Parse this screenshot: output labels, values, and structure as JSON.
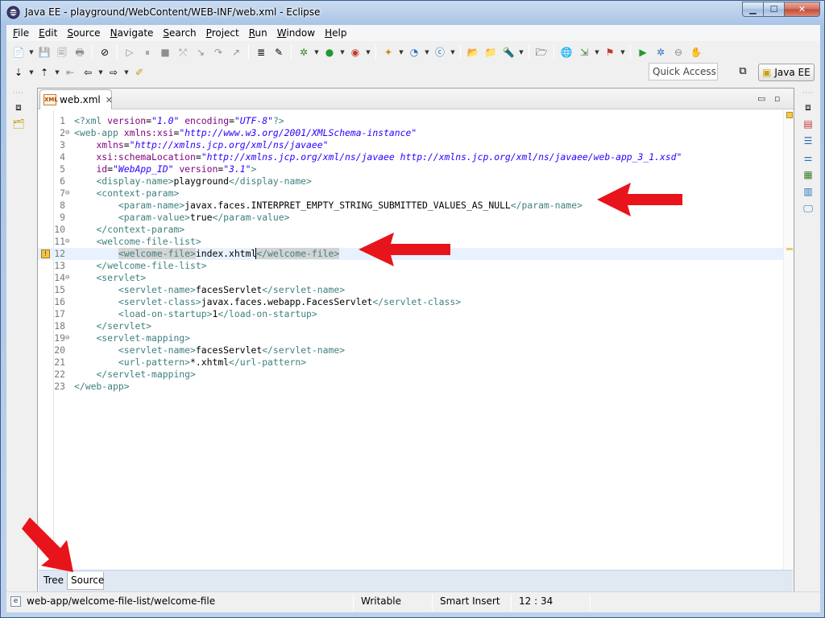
{
  "window": {
    "title": "Java EE - playground/WebContent/WEB-INF/web.xml - Eclipse",
    "min_label": "▁",
    "max_label": "☐",
    "close_label": "✕"
  },
  "menubar": [
    {
      "mnemonic": "F",
      "rest": "ile"
    },
    {
      "mnemonic": "E",
      "rest": "dit"
    },
    {
      "mnemonic": "S",
      "rest": "ource"
    },
    {
      "mnemonic": "N",
      "rest": "avigate"
    },
    {
      "mnemonic": "S",
      "rest": "earch"
    },
    {
      "mnemonic": "P",
      "rest": "roject"
    },
    {
      "mnemonic": "R",
      "rest": "un"
    },
    {
      "mnemonic": "W",
      "rest": "indow"
    },
    {
      "mnemonic": "H",
      "rest": "elp"
    }
  ],
  "toolbar": {
    "quick_access": "Quick Access",
    "perspective": "Java EE"
  },
  "editor": {
    "tab_label": "web.xml",
    "tab_icon_text": "XML",
    "close_glyph": "✕",
    "minimize_glyph": "▭",
    "maximize_glyph": "▫",
    "lines": [
      {
        "n": "1",
        "fold": "",
        "html": "<span class=\"tag\">&lt;?xml</span> <span class=\"attr\">version</span>=<span class=\"str\">\"1.0\"</span> <span class=\"attr\">encoding</span>=<span class=\"str\">\"UTF-8\"</span><span class=\"tag\">?&gt;</span>"
      },
      {
        "n": "2",
        "fold": "⊖",
        "html": "<span class=\"tag\">&lt;web-app</span> <span class=\"attr\">xmlns:xsi</span>=<span class=\"str\">\"http://www.w3.org/2001/XMLSchema-instance\"</span>"
      },
      {
        "n": "3",
        "fold": "",
        "html": "    <span class=\"attr\">xmlns</span>=<span class=\"str\">\"http://xmlns.jcp.org/xml/ns/javaee\"</span>"
      },
      {
        "n": "4",
        "fold": "",
        "html": "    <span class=\"attr\">xsi:schemaLocation</span>=<span class=\"str\">\"http://xmlns.jcp.org/xml/ns/javaee http://xmlns.jcp.org/xml/ns/javaee/web-app_3_1.xsd\"</span>"
      },
      {
        "n": "5",
        "fold": "",
        "html": "    <span class=\"attr\">id</span>=<span class=\"str\">\"WebApp_ID\"</span> <span class=\"attr\">version</span>=<span class=\"str\">\"3.1\"</span><span class=\"tag\">&gt;</span>"
      },
      {
        "n": "6",
        "fold": "",
        "html": "    <span class=\"tag\">&lt;display-name&gt;</span><span class=\"txt\">playground</span><span class=\"tag\">&lt;/display-name&gt;</span>"
      },
      {
        "n": "7",
        "fold": "⊖",
        "html": "    <span class=\"tag\">&lt;context-param&gt;</span>"
      },
      {
        "n": "8",
        "fold": "",
        "html": "        <span class=\"tag\">&lt;param-name&gt;</span><span class=\"txt\">javax.faces.INTERPRET_EMPTY_STRING_SUBMITTED_VALUES_AS_NULL</span><span class=\"tag\">&lt;/param-name&gt;</span>"
      },
      {
        "n": "9",
        "fold": "",
        "html": "        <span class=\"tag\">&lt;param-value&gt;</span><span class=\"txt\">true</span><span class=\"tag\">&lt;/param-value&gt;</span>"
      },
      {
        "n": "10",
        "fold": "",
        "html": "    <span class=\"tag\">&lt;/context-param&gt;</span>"
      },
      {
        "n": "11",
        "fold": "⊖",
        "html": "    <span class=\"tag\">&lt;welcome-file-list&gt;</span>"
      },
      {
        "n": "12",
        "fold": "",
        "current": true,
        "html": "        <span class=\"tag hl\">&lt;welcome-file&gt;</span><span class=\"txt\">index.xhtml</span><span class=\"tag hl caret\">&lt;/welcome-file&gt;</span>"
      },
      {
        "n": "13",
        "fold": "",
        "html": "    <span class=\"tag\">&lt;/welcome-file-list&gt;</span>"
      },
      {
        "n": "14",
        "fold": "⊖",
        "html": "    <span class=\"tag\">&lt;servlet&gt;</span>"
      },
      {
        "n": "15",
        "fold": "",
        "html": "        <span class=\"tag\">&lt;servlet-name&gt;</span><span class=\"txt\">facesServlet</span><span class=\"tag\">&lt;/servlet-name&gt;</span>"
      },
      {
        "n": "16",
        "fold": "",
        "html": "        <span class=\"tag\">&lt;servlet-class&gt;</span><span class=\"txt\">javax.faces.webapp.FacesServlet</span><span class=\"tag\">&lt;/servlet-class&gt;</span>"
      },
      {
        "n": "17",
        "fold": "",
        "html": "        <span class=\"tag\">&lt;load-on-startup&gt;</span><span class=\"txt\">1</span><span class=\"tag\">&lt;/load-on-startup&gt;</span>"
      },
      {
        "n": "18",
        "fold": "",
        "html": "    <span class=\"tag\">&lt;/servlet&gt;</span>"
      },
      {
        "n": "19",
        "fold": "⊖",
        "html": "    <span class=\"tag\">&lt;servlet-mapping&gt;</span>"
      },
      {
        "n": "20",
        "fold": "",
        "html": "        <span class=\"tag\">&lt;servlet-name&gt;</span><span class=\"txt\">facesServlet</span><span class=\"tag\">&lt;/servlet-name&gt;</span>"
      },
      {
        "n": "21",
        "fold": "",
        "html": "        <span class=\"tag\">&lt;url-pattern&gt;</span><span class=\"txt\">*.xhtml</span><span class=\"tag\">&lt;/url-pattern&gt;</span>"
      },
      {
        "n": "22",
        "fold": "",
        "html": "    <span class=\"tag\">&lt;/servlet-mapping&gt;</span>"
      },
      {
        "n": "23",
        "fold": "",
        "html": "<span class=\"tag\">&lt;/web-app&gt;</span>"
      }
    ],
    "bottom_tabs": {
      "tree": "Tree",
      "source": "Source"
    }
  },
  "status": {
    "path": "web-app/welcome-file-list/welcome-file",
    "mode": "Writable",
    "insert": "Smart Insert",
    "position": "12 : 34"
  },
  "colors": {
    "tag": "#3f7f7f",
    "attribute": "#7f007f",
    "string": "#2a00ff",
    "annotation_arrow": "#e8141b",
    "current_line": "#e8f2fe"
  }
}
